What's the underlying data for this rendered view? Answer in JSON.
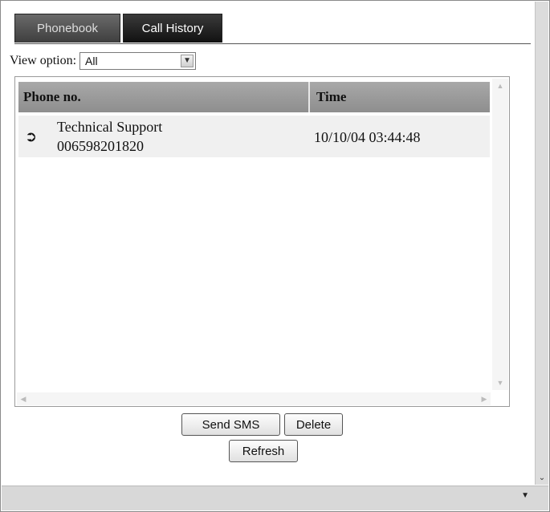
{
  "tabs": [
    {
      "label": "Phonebook",
      "active": false
    },
    {
      "label": "Call History",
      "active": true
    }
  ],
  "view_option": {
    "label": "View option:",
    "value": "All"
  },
  "table": {
    "columns": [
      "Phone no.",
      "Time"
    ],
    "rows": [
      {
        "icon": "outgoing-call-icon",
        "name": "Technical Support",
        "number": "006598201820",
        "time": "10/10/04 03:44:48"
      }
    ]
  },
  "buttons": {
    "send_sms": "Send SMS",
    "delete": "Delete",
    "refresh": "Refresh"
  }
}
